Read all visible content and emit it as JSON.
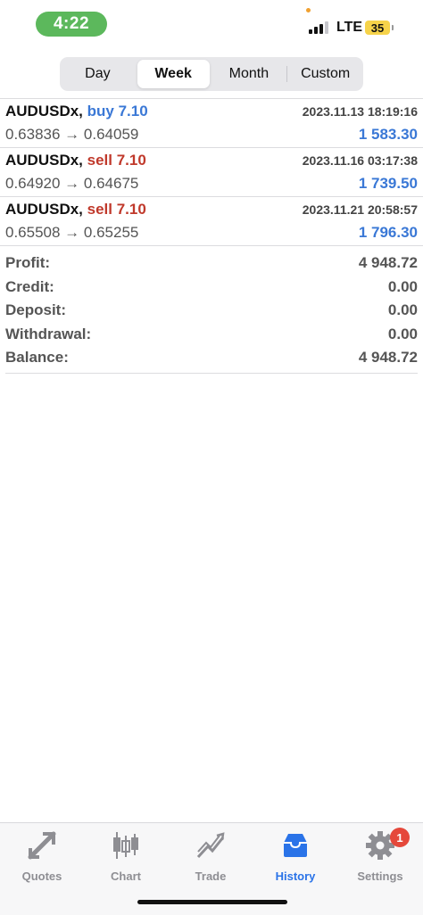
{
  "status_bar": {
    "time": "4:22",
    "network": "LTE",
    "battery": "35"
  },
  "period_tabs": [
    {
      "label": "Day",
      "active": false
    },
    {
      "label": "Week",
      "active": true
    },
    {
      "label": "Month",
      "active": false
    },
    {
      "label": "Custom",
      "active": false
    }
  ],
  "deals": [
    {
      "symbol": "AUDUSDx,",
      "side": "buy 7.10",
      "side_type": "buy",
      "datetime": "2023.11.13 18:19:16",
      "prices": "0.63836 → 0.64059",
      "profit": "1 583.30"
    },
    {
      "symbol": "AUDUSDx,",
      "side": "sell 7.10",
      "side_type": "sell",
      "datetime": "2023.11.16 03:17:38",
      "prices": "0.64920 → 0.64675",
      "profit": "1 739.50"
    },
    {
      "symbol": "AUDUSDx,",
      "side": "sell 7.10",
      "side_type": "sell",
      "datetime": "2023.11.21 20:58:57",
      "prices": "0.65508 → 0.65255",
      "profit": "1 796.30"
    }
  ],
  "summary": [
    {
      "label": "Profit:",
      "value": "4 948.72"
    },
    {
      "label": "Credit:",
      "value": "0.00"
    },
    {
      "label": "Deposit:",
      "value": "0.00"
    },
    {
      "label": "Withdrawal:",
      "value": "0.00"
    },
    {
      "label": "Balance:",
      "value": "4 948.72"
    }
  ],
  "tabbar": {
    "items": [
      {
        "label": "Quotes",
        "icon": "quotes-icon",
        "active": false
      },
      {
        "label": "Chart",
        "icon": "chart-icon",
        "active": false
      },
      {
        "label": "Trade",
        "icon": "trade-icon",
        "active": false
      },
      {
        "label": "History",
        "icon": "history-icon",
        "active": true
      },
      {
        "label": "Settings",
        "icon": "settings-icon",
        "active": false
      }
    ],
    "settings_badge": "1"
  },
  "colors": {
    "accent": "#2a73e8",
    "buy": "#3a78d6",
    "sell": "#c0392b",
    "time_pill": "#5cb85c",
    "badge": "#e5483b"
  }
}
